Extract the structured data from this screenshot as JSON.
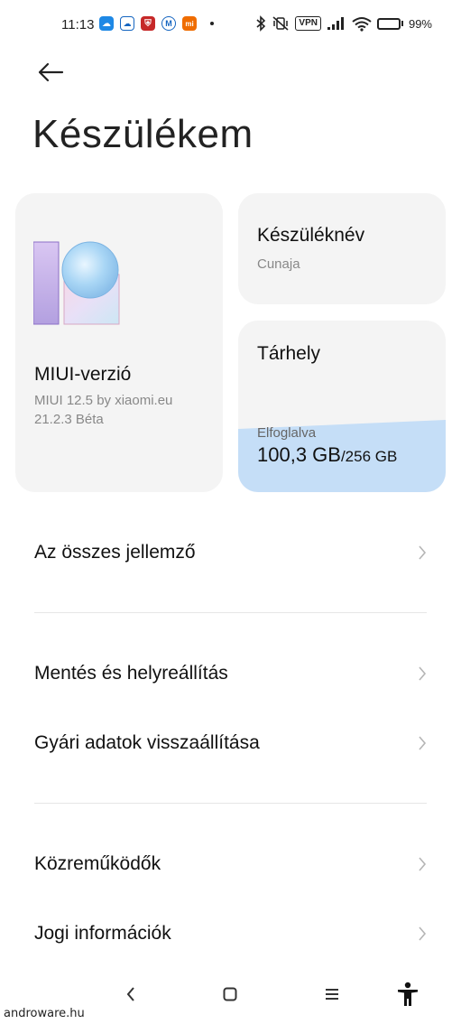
{
  "status_bar": {
    "time": "11:13",
    "app_icons": [
      "cloud-app-icon",
      "weather-icon",
      "shield-app-icon",
      "m-app-icon",
      "mi-app-icon"
    ],
    "vpn_label": "VPN",
    "battery_percent": "99%",
    "battery_level": 0.99,
    "battery_color": "#2ecc40"
  },
  "header": {
    "back_icon": "arrow-left-icon",
    "title": "Készülékem"
  },
  "cards": {
    "miui": {
      "title": "MIUI-verzió",
      "version_line1": "MIUI 12.5 by xiaomi.eu",
      "version_line2": "21.2.3 Béta"
    },
    "device_name": {
      "title": "Készüléknév",
      "value": "Cunaja"
    },
    "storage": {
      "title": "Tárhely",
      "used_label": "Elfoglalva",
      "used": "100,3 GB",
      "total": "/256 GB",
      "used_fraction": 0.39,
      "fill_color": "#c5def7"
    }
  },
  "list": {
    "all_specs": "Az összes jellemző",
    "backup_restore": "Mentés és helyreállítás",
    "factory_reset": "Gyári adatok visszaállítása",
    "contributors": "Közreműködők",
    "legal_info": "Jogi információk"
  },
  "nav_bar": {
    "back_icon": "nav-back-icon",
    "home_icon": "nav-home-icon",
    "menu_icon": "nav-menu-icon",
    "accessibility_icon": "accessibility-icon"
  },
  "watermark": "androware.hu"
}
